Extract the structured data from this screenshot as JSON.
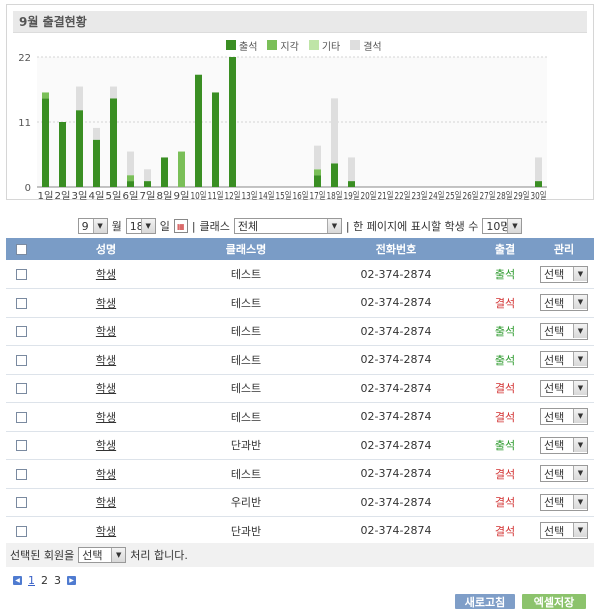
{
  "chart_title": "9월 출결현황",
  "legend": [
    {
      "label": "출석",
      "color": "#3a8e23"
    },
    {
      "label": "지각",
      "color": "#7abf58"
    },
    {
      "label": "기타",
      "color": "#bfe5a7"
    },
    {
      "label": "결석",
      "color": "#dedede"
    }
  ],
  "chart_data": {
    "type": "bar",
    "stacked": true,
    "categories": [
      "1일",
      "2일",
      "3일",
      "4일",
      "5일",
      "6일",
      "7일",
      "8일",
      "9일",
      "10일",
      "11일",
      "12일",
      "13일",
      "14일",
      "15일",
      "16일",
      "17일",
      "18일",
      "19일",
      "20일",
      "21일",
      "22일",
      "23일",
      "24일",
      "25일",
      "26일",
      "27일",
      "28일",
      "29일",
      "30일"
    ],
    "series": [
      {
        "name": "출석",
        "color": "#3a8e23",
        "values": [
          15,
          11,
          13,
          8,
          15,
          1,
          1,
          5,
          0,
          19,
          16,
          22,
          0,
          0,
          0,
          0,
          2,
          4,
          1,
          0,
          0,
          0,
          0,
          0,
          0,
          0,
          0,
          0,
          0,
          1
        ]
      },
      {
        "name": "지각",
        "color": "#7abf58",
        "values": [
          1,
          0,
          0,
          0,
          0,
          1,
          0,
          0,
          6,
          0,
          0,
          0,
          0,
          0,
          0,
          0,
          1,
          0,
          0,
          0,
          0,
          0,
          0,
          0,
          0,
          0,
          0,
          0,
          0,
          0
        ]
      },
      {
        "name": "기타",
        "color": "#bfe5a7",
        "values": [
          0,
          0,
          0,
          0,
          0,
          0,
          0,
          0,
          0,
          0,
          0,
          0,
          0,
          0,
          0,
          0,
          0,
          0,
          0,
          0,
          0,
          0,
          0,
          0,
          0,
          0,
          0,
          0,
          0,
          0
        ]
      },
      {
        "name": "결석",
        "color": "#dedede",
        "values": [
          0,
          0,
          4,
          2,
          2,
          4,
          2,
          0,
          0,
          0,
          0,
          0,
          0,
          0,
          0,
          0,
          4,
          11,
          4,
          0,
          0,
          0,
          0,
          0,
          0,
          0,
          0,
          0,
          0,
          4
        ]
      }
    ],
    "yticks": [
      0,
      11,
      22
    ],
    "ylim": [
      0,
      22
    ],
    "grid": true
  },
  "filter": {
    "month_value": "9",
    "month_unit": "월",
    "day_value": "18",
    "day_unit": "일",
    "separator": "|",
    "class_label": "클래스",
    "class_value": "전체",
    "per_page_label": "| 한 페이지에 표시할 학생 수",
    "per_page_value": "10명"
  },
  "table": {
    "headers": {
      "name": "성명",
      "class": "클래스명",
      "phone": "전화번호",
      "attendance": "출결",
      "manage": "관리"
    },
    "rows": [
      {
        "name": "학생",
        "class": "테스트",
        "phone": "02-374-2874",
        "status": "출석",
        "status_type": "present",
        "manage": "선택"
      },
      {
        "name": "학생",
        "class": "테스트",
        "phone": "02-374-2874",
        "status": "결석",
        "status_type": "absent",
        "manage": "선택"
      },
      {
        "name": "학생",
        "class": "테스트",
        "phone": "02-374-2874",
        "status": "출석",
        "status_type": "present",
        "manage": "선택"
      },
      {
        "name": "학생",
        "class": "테스트",
        "phone": "02-374-2874",
        "status": "출석",
        "status_type": "present",
        "manage": "선택"
      },
      {
        "name": "학생",
        "class": "테스트",
        "phone": "02-374-2874",
        "status": "결석",
        "status_type": "absent",
        "manage": "선택"
      },
      {
        "name": "학생",
        "class": "테스트",
        "phone": "02-374-2874",
        "status": "결석",
        "status_type": "absent",
        "manage": "선택"
      },
      {
        "name": "학생",
        "class": "단과반",
        "phone": "02-374-2874",
        "status": "출석",
        "status_type": "present",
        "manage": "선택"
      },
      {
        "name": "학생",
        "class": "테스트",
        "phone": "02-374-2874",
        "status": "결석",
        "status_type": "absent",
        "manage": "선택"
      },
      {
        "name": "학생",
        "class": "우리반",
        "phone": "02-374-2874",
        "status": "결석",
        "status_type": "absent",
        "manage": "선택"
      },
      {
        "name": "학생",
        "class": "단과반",
        "phone": "02-374-2874",
        "status": "결석",
        "status_type": "absent",
        "manage": "선택"
      }
    ]
  },
  "bulk": {
    "prefix": "선택된 회원을",
    "select_value": "선택",
    "suffix": "처리 합니다."
  },
  "pager": {
    "pages": [
      "1",
      "2",
      "3"
    ],
    "current": "1"
  },
  "buttons": {
    "refresh": "새로고침",
    "excel": "엑셀저장"
  }
}
